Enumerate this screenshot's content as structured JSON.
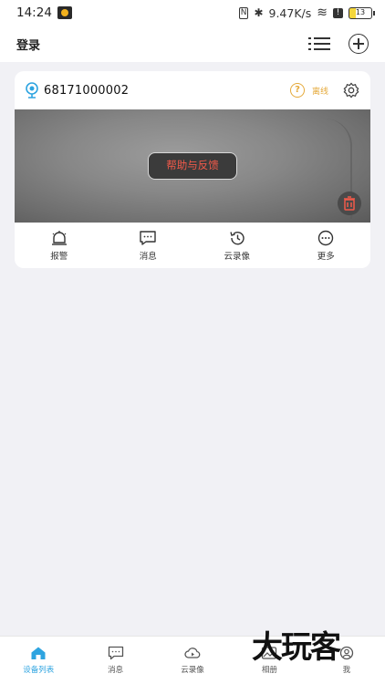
{
  "status_bar": {
    "time": "14:24",
    "nfc": "N",
    "bluetooth": "✱",
    "speed": "9.47K/s",
    "wifi": "≋",
    "alert": "!",
    "battery": "13"
  },
  "header": {
    "title": "登录",
    "list_icon": "list-icon",
    "add_icon": "add-icon"
  },
  "device": {
    "id": "68171000002",
    "status": "离线",
    "help_label": "帮助与反馈",
    "actions": [
      {
        "label": "报警",
        "icon": "alarm-bell-icon"
      },
      {
        "label": "消息",
        "icon": "message-icon"
      },
      {
        "label": "云录像",
        "icon": "history-icon"
      },
      {
        "label": "更多",
        "icon": "more-icon"
      }
    ]
  },
  "bottom_nav": [
    {
      "label": "设备列表",
      "icon": "home-icon",
      "active": true
    },
    {
      "label": "消息",
      "icon": "message-icon",
      "active": false
    },
    {
      "label": "云录像",
      "icon": "cloud-play-icon",
      "active": false
    },
    {
      "label": "相册",
      "icon": "album-icon",
      "active": false
    },
    {
      "label": "我",
      "icon": "profile-icon",
      "active": false
    }
  ],
  "watermark": "大玩客",
  "colors": {
    "accent": "#2ea4e0",
    "warning": "#e5a93a",
    "help_text": "#f25a4a",
    "background": "#f1f1f5"
  }
}
